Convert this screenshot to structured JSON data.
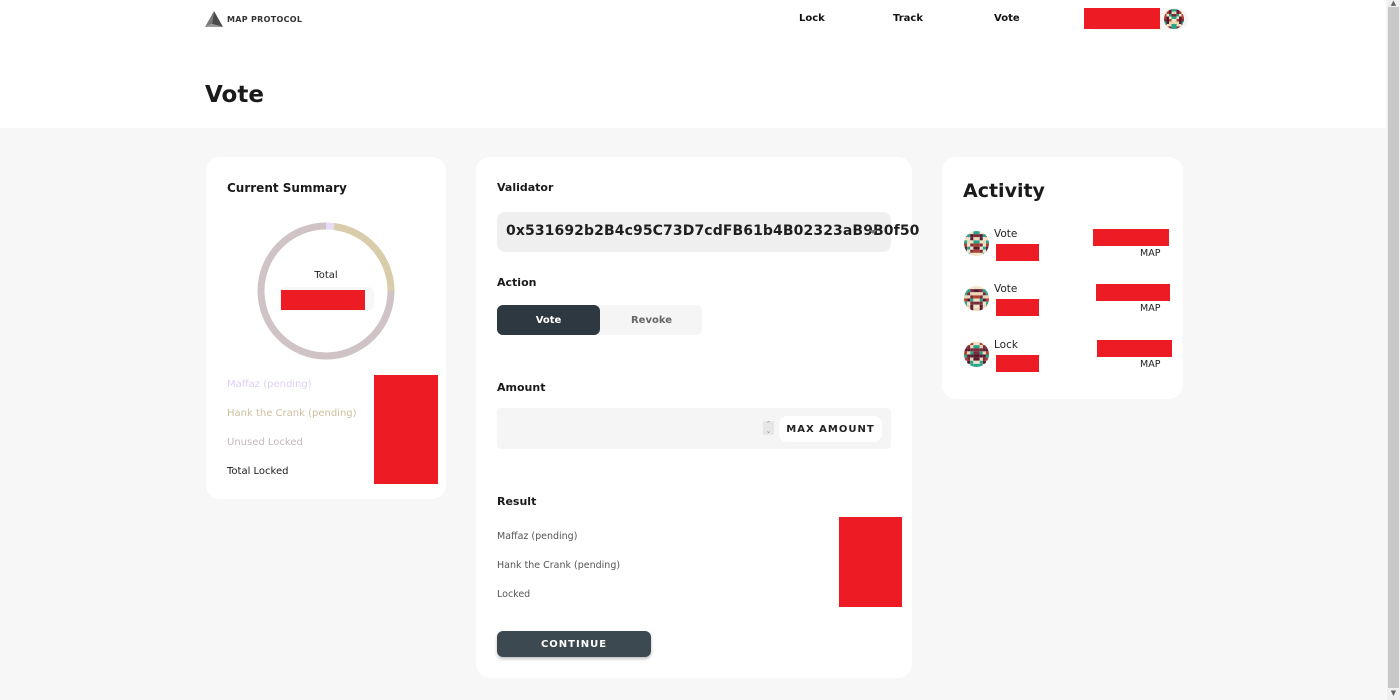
{
  "header": {
    "logo_text": "MAP PROTOCOL",
    "nav": [
      {
        "label": "Lock"
      },
      {
        "label": "Track"
      },
      {
        "label": "Vote"
      }
    ],
    "wallet_address_redacted": true
  },
  "page": {
    "title": "Vote"
  },
  "summary": {
    "title": "Current Summary",
    "center_label": "Total",
    "center_value_redacted": true,
    "donut_segments": [
      {
        "name": "Maffaz (pending)",
        "fraction": 0.02,
        "color": "#e6dcf5"
      },
      {
        "name": "Hank the Crank (pending)",
        "fraction": 0.23,
        "color": "#d8ccaa"
      },
      {
        "name": "Unused Locked",
        "fraction": 0.75,
        "color": "#cfc3c6"
      }
    ],
    "legend": [
      {
        "label": "Maffaz (pending)",
        "color": "#ddd0f4"
      },
      {
        "label": "Hank the Crank (pending)",
        "color": "#cbbf9e"
      },
      {
        "label": "Unused Locked",
        "color": "#c4b8bb"
      },
      {
        "label": "Total Locked",
        "color": "#1a1a1a"
      }
    ],
    "values_redacted": true
  },
  "form": {
    "validator_label": "Validator",
    "validator_value": "0x531692b2B4c95C73D7cdFB61b4B02323aB9B0f50",
    "action_label": "Action",
    "action_options": [
      "Vote",
      "Revoke"
    ],
    "action_selected": "Vote",
    "amount_label": "Amount",
    "amount_value": "",
    "max_button": "MAX AMOUNT",
    "result_label": "Result",
    "result_items": [
      {
        "label": "Maffaz (pending)"
      },
      {
        "label": "Hank the Crank (pending)"
      },
      {
        "label": "Locked"
      }
    ],
    "result_values_redacted": true,
    "continue_button": "CONTINUE"
  },
  "activity": {
    "title": "Activity",
    "items": [
      {
        "type": "Vote",
        "unit": "MAP",
        "amount_redacted": true
      },
      {
        "type": "Vote",
        "unit": "MAP",
        "amount_redacted": true
      },
      {
        "type": "Lock",
        "unit": "MAP",
        "amount_redacted": true
      }
    ]
  },
  "colors": {
    "primary_dark": "#2d3840",
    "redaction": "#ed1c24",
    "background": "#f7f7f7"
  }
}
